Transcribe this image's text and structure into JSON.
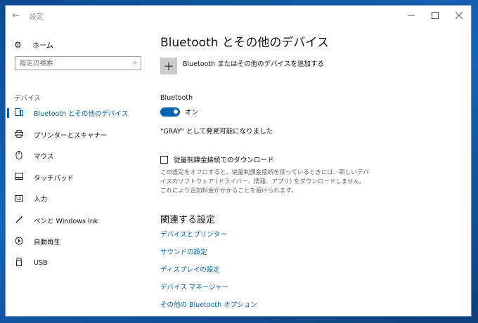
{
  "window": {
    "title": "設定"
  },
  "sidebar": {
    "home_label": "ホーム",
    "search_placeholder": "設定の検索",
    "section_header": "デバイス",
    "items": [
      {
        "label": "Bluetooth とその他のデバイス",
        "icon": "bluetooth-devices-icon",
        "active": true
      },
      {
        "label": "プリンターとスキャナー",
        "icon": "printer-icon"
      },
      {
        "label": "マウス",
        "icon": "mouse-icon"
      },
      {
        "label": "タッチパッド",
        "icon": "touchpad-icon"
      },
      {
        "label": "入力",
        "icon": "keyboard-icon"
      },
      {
        "label": "ペンと Windows Ink",
        "icon": "pen-icon"
      },
      {
        "label": "自動再生",
        "icon": "autoplay-icon"
      },
      {
        "label": "USB",
        "icon": "usb-icon"
      }
    ]
  },
  "main": {
    "title": "Bluetooth とその他のデバイス",
    "add_device_label": "Bluetooth またはその他のデバイスを追加する",
    "bluetooth_label": "Bluetooth",
    "toggle_state": "オン",
    "discoverable_text": "\"GRAY\" として発見可能になりました",
    "metered_label": "従量制課金接続でのダウンロード",
    "metered_desc": "この設定をオフにすると、従量制課金接続を使っているときには、新しいデバイスのソフトウェア (ドライバー、情報、アプリ) をダウンロードしません。これにより追加料金がかかることを避けられます。",
    "related_header": "関連する設定",
    "related_links": [
      "デバイスとプリンター",
      "サウンドの設定",
      "ディスプレイの設定",
      "デバイス マネージャー",
      "その他の Bluetooth オプション"
    ]
  },
  "colors": {
    "accent": "#0063b1"
  }
}
